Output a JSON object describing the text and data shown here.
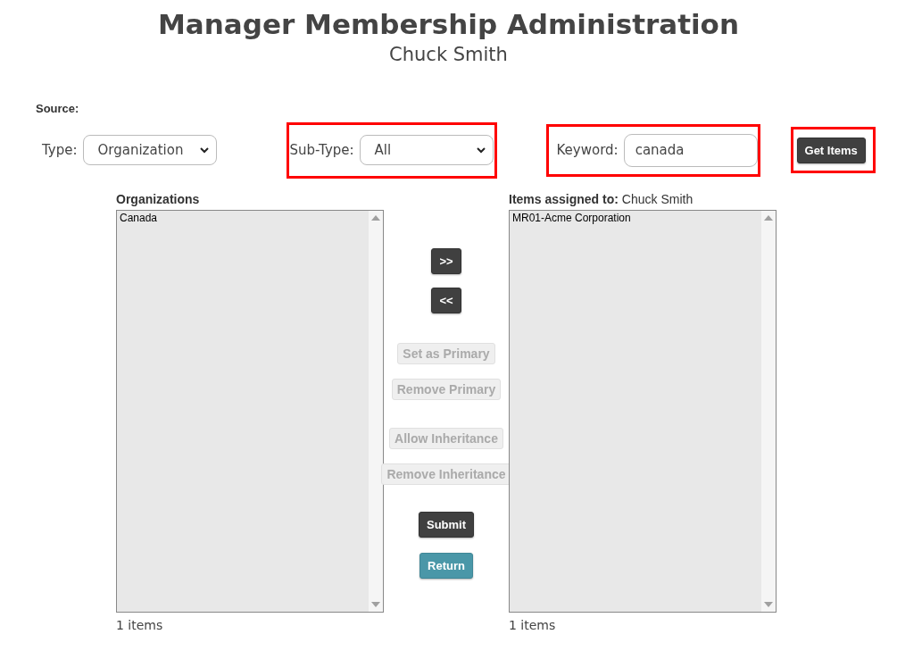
{
  "page": {
    "title": "Manager Membership Administration",
    "subtitle": "Chuck Smith"
  },
  "source": {
    "heading": "Source:",
    "type": {
      "label": "Type:",
      "value": "Organization",
      "highlighted": false
    },
    "sub_type": {
      "label": "Sub-Type:",
      "value": "All",
      "highlighted": true
    },
    "keyword": {
      "label": "Keyword:",
      "value": "canada",
      "highlighted": true
    },
    "get_items": {
      "label": "Get Items",
      "highlighted": true
    }
  },
  "available": {
    "heading": "Organizations",
    "items": [
      {
        "label": "Canada",
        "selected": false
      }
    ],
    "count": "1 items"
  },
  "assigned": {
    "heading": "**Items assigned to:** Chuck Smith",
    "items": [
      {
        "label": "MR01-Acme Corporation",
        "selected": false
      }
    ],
    "count": "1 items"
  },
  "button_groups": [
    [
      {
        "label": ">>",
        "kind": "dark",
        "disabled": false
      },
      {
        "label": "<<",
        "kind": "dark",
        "disabled": false
      }
    ],
    [
      {
        "label": "Set as Primary",
        "kind": "dark",
        "disabled": true
      },
      {
        "label": "Remove Primary",
        "kind": "dark",
        "disabled": true
      }
    ],
    [
      {
        "label": "Allow Inheritance",
        "kind": "dark",
        "disabled": true
      },
      {
        "label": "Remove Inheritance",
        "kind": "dark",
        "disabled": true
      }
    ],
    [
      {
        "label": "Submit",
        "kind": "dark",
        "disabled": false
      },
      {
        "label": "Return",
        "kind": "teal",
        "disabled": false
      }
    ]
  ]
}
